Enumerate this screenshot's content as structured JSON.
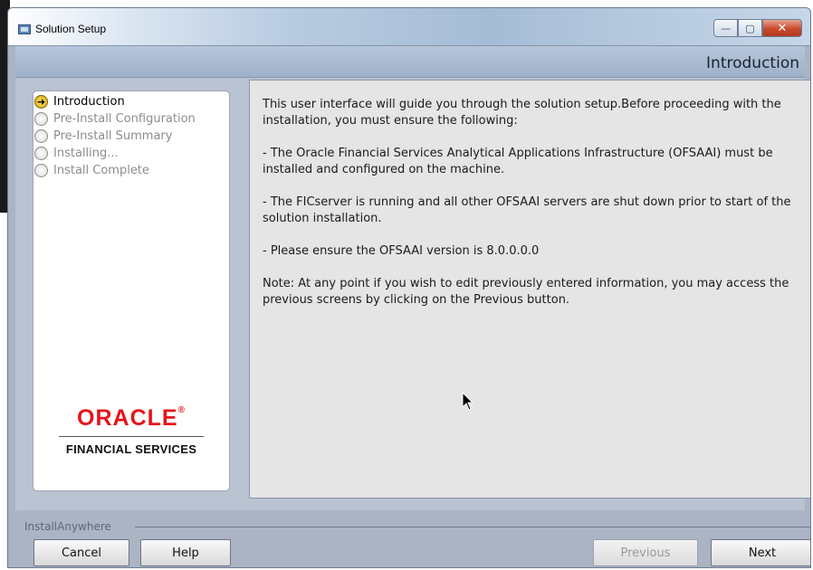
{
  "window": {
    "title": "Solution Setup",
    "icon": "installer-icon",
    "controls": {
      "minimize": "—",
      "maximize": "▢",
      "close": "✕"
    }
  },
  "banner": {
    "title": "Introduction"
  },
  "steps": [
    {
      "label": "Introduction",
      "state": "current"
    },
    {
      "label": "Pre-Install Configuration",
      "state": "pending"
    },
    {
      "label": "Pre-Install Summary",
      "state": "pending"
    },
    {
      "label": "Installing...",
      "state": "pending"
    },
    {
      "label": "Install Complete",
      "state": "pending"
    }
  ],
  "logo": {
    "brand": "ORACLE",
    "mark": "®",
    "subtitle": "FINANCIAL SERVICES"
  },
  "info": {
    "paragraphs": [
      "This user interface will guide you through the solution setup.Before proceeding with the installation, you must ensure the following:",
      "- The Oracle Financial Services Analytical Applications Infrastructure (OFSAAI) must be installed and configured on the machine.",
      "- The FICserver is running and all other OFSAAI servers are shut down prior to start of the solution installation.",
      "- Please ensure the OFSAAI version is 8.0.0.0.0",
      "Note: At any point if you wish to edit previously entered information, you may access the previous screens by clicking on the Previous button."
    ]
  },
  "footer": {
    "label": "InstallAnywhere",
    "buttons": {
      "cancel": "Cancel",
      "help": "Help",
      "previous": "Previous",
      "next": "Next"
    }
  },
  "colors": {
    "oracle_red": "#e5141b",
    "window_chrome": "#aab4c4",
    "info_background": "#e5e5e5"
  }
}
